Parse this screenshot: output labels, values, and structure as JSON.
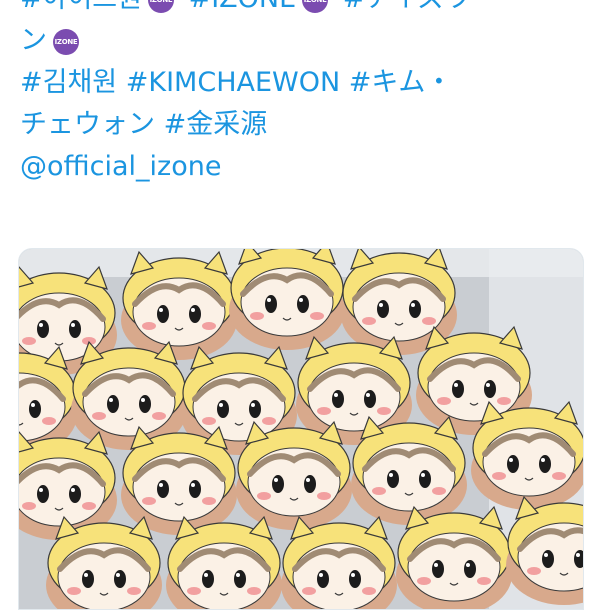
{
  "tweet": {
    "line1": [
      "#아이즈원",
      "#IZONE",
      "#アイズワ"
    ],
    "line2_text": "ン",
    "line3": [
      "#김채원",
      "#KIMCHAEWON",
      "#キム・"
    ],
    "line4": [
      "チェウォン",
      "#金采源"
    ],
    "mention": "@official_izone",
    "badge_label": "IZONE"
  },
  "image": {
    "subject": "character-face-cookies",
    "colors": {
      "tray": "#c9cdd2",
      "cookie_base": "#d8a98c",
      "face": "#fbf1e6",
      "hood": "#f7e27a",
      "hair": "#a08b74",
      "cheek": "#f2a0a0"
    }
  }
}
